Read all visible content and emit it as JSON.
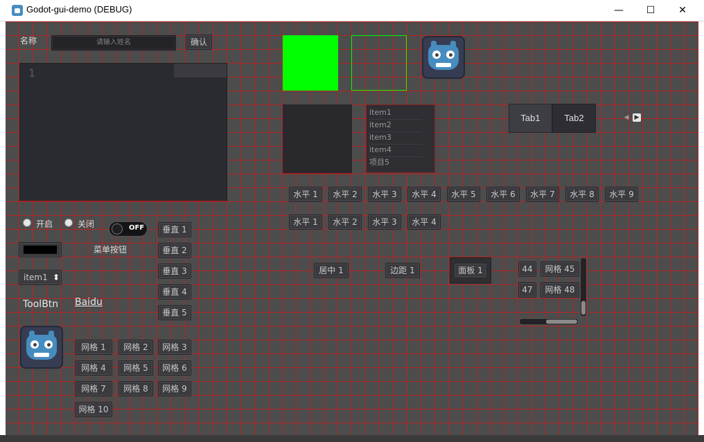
{
  "window": {
    "title": "Godot-gui-demo (DEBUG)",
    "minimize_label": "—",
    "maximize_label": "☐",
    "close_label": "✕"
  },
  "form": {
    "name_label": "名称",
    "name_placeholder": "请输入姓名",
    "confirm_label": "确认",
    "textedit_line_number": "1"
  },
  "radios": {
    "open_label": "开启",
    "close_label": "关闭"
  },
  "toggle": {
    "label": "OFF"
  },
  "color_picker": {
    "color": "#000000"
  },
  "menu_button": {
    "label": "菜单按钮"
  },
  "option_button": {
    "selected": "item1",
    "arrow": "⬍"
  },
  "tool_button": {
    "label": "ToolBtn"
  },
  "link_button": {
    "label": "Baidu"
  },
  "vertical_buttons": [
    "垂直 1",
    "垂直 2",
    "垂直 3",
    "垂直 4",
    "垂直 5"
  ],
  "grid_buttons": [
    "网格 1",
    "网格 2",
    "网格 3",
    "网格 4",
    "网格 5",
    "网格 6",
    "网格 7",
    "网格 8",
    "网格 9",
    "网格 10"
  ],
  "color_rects": {
    "filled": "#00ff00",
    "outline": "#00ff00"
  },
  "item_list": [
    "item1",
    "item2",
    "item3",
    "item4",
    "项目5"
  ],
  "tabs": {
    "items": [
      "Tab1",
      "Tab2"
    ],
    "active_index": 0,
    "prev_arrow": "◀",
    "next_arrow": "▶"
  },
  "horizontal_row1": [
    "水平 1",
    "水平 2",
    "水平 3",
    "水平 4",
    "水平 5",
    "水平 6",
    "水平 7",
    "水平 8",
    "水平 9"
  ],
  "horizontal_row2": [
    "水平 1",
    "水平 2",
    "水平 3",
    "水平 4"
  ],
  "containers": {
    "center_label": "居中 1",
    "margin_label": "边距 1",
    "panel_label": "面板 1"
  },
  "scroll_grid": [
    "44",
    "网格 45",
    "47",
    "网格 48"
  ],
  "scroll": {
    "horizontal_position": 0.45,
    "vertical_position": 0.85
  }
}
